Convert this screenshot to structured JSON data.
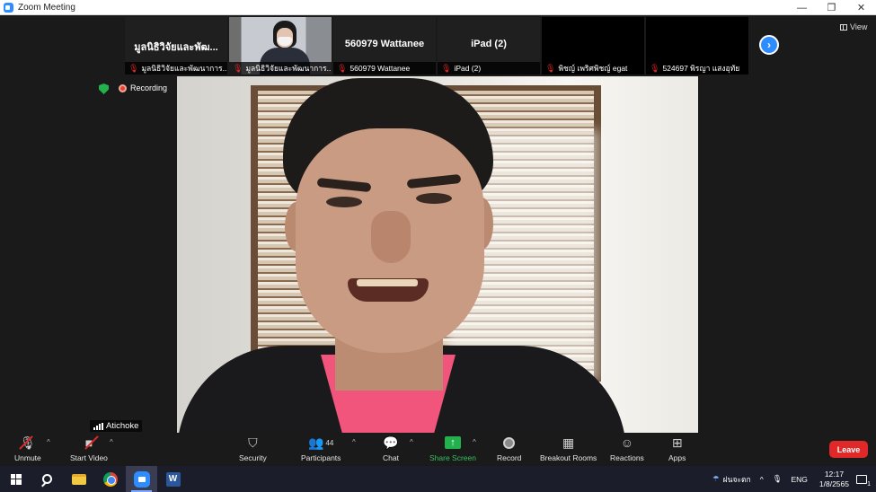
{
  "window": {
    "title": "Zoom Meeting",
    "controls": [
      "—",
      "❐",
      "✕"
    ]
  },
  "thumbnails": [
    {
      "big_name": "มูลนิธิวิจัยและพัฒ...",
      "caption": "มูลนิธิวิจัยและพัฒนาการ...",
      "muted": true,
      "has_video": false
    },
    {
      "big_name": "",
      "caption": "มูลนิธิวิจัยและพัฒนาการ...",
      "muted": true,
      "has_video": true
    },
    {
      "big_name": "560979 Wattanee",
      "caption": "560979 Wattanee",
      "muted": true,
      "has_video": false
    },
    {
      "big_name": "iPad (2)",
      "caption": "iPad (2)",
      "muted": true,
      "has_video": false
    },
    {
      "big_name": "",
      "caption": "พิชญ์ เพริศพิชญ์ egat",
      "muted": true,
      "has_video": false
    },
    {
      "big_name": "",
      "caption": "524697 พิรญา แสงอุทัย",
      "muted": true,
      "has_video": false
    }
  ],
  "view_button": "View",
  "recording_label": "Recording",
  "active_speaker": "Atichoke",
  "toolbar": {
    "unmute": "Unmute",
    "start_video": "Start Video",
    "security": "Security",
    "participants": "Participants",
    "participants_count": "44",
    "chat": "Chat",
    "share_screen": "Share Screen",
    "record": "Record",
    "breakout_rooms": "Breakout Rooms",
    "reactions": "Reactions",
    "apps": "Apps",
    "leave": "Leave"
  },
  "taskbar": {
    "weather": "ฝนจะตก",
    "language": "ENG",
    "time": "12:17",
    "date": "1/8/2565",
    "notifications": "1"
  },
  "colors": {
    "zoom_blue": "#2d8cff",
    "share_green": "#23b14d",
    "leave_red": "#e02828"
  }
}
